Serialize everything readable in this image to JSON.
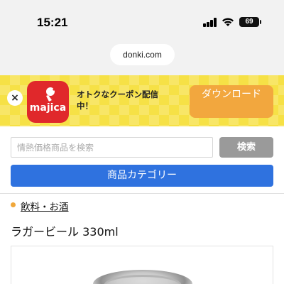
{
  "status_bar": {
    "time": "15:21",
    "battery": "69",
    "icons": [
      "cellular-signal-icon",
      "wifi-icon",
      "battery-icon"
    ]
  },
  "browser": {
    "url": "donki.com"
  },
  "app_banner": {
    "app_name": "majica",
    "promo_text": "オトクなクーポン配信中！",
    "download_label": "ダウンロード",
    "close_icon": "×",
    "colors": {
      "banner": "#f6e146",
      "icon": "#e0282b",
      "download": "#f2a73e"
    }
  },
  "search": {
    "placeholder": "情熱価格商品を検索",
    "button_label": "検索"
  },
  "category_button": {
    "label": "商品カテゴリー",
    "color": "#2f72df"
  },
  "breadcrumb": {
    "label": "飲料・お酒",
    "dot_color": "#f0a73a"
  },
  "product": {
    "title": "ラガービール 330ml"
  }
}
